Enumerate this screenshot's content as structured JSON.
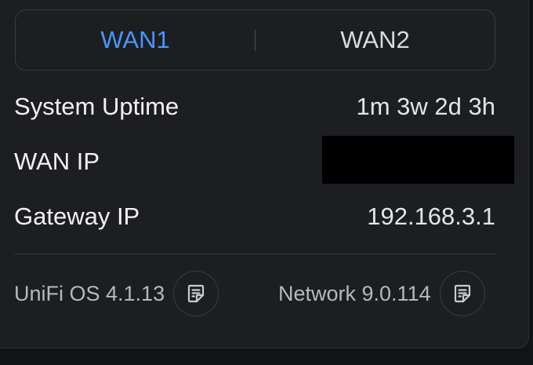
{
  "tabs": [
    {
      "label": "WAN1",
      "active": true
    },
    {
      "label": "WAN2",
      "active": false
    }
  ],
  "stats": {
    "uptime_label": "System Uptime",
    "uptime_value": "1m 3w 2d 3h",
    "wan_ip_label": "WAN IP",
    "gateway_label": "Gateway IP",
    "gateway_value": "192.168.3.1"
  },
  "footer": {
    "os_version": "UniFi OS 4.1.13",
    "network_version": "Network 9.0.114"
  },
  "icons": {
    "release_notes": "notes-icon"
  },
  "colors": {
    "accent": "#4797ff",
    "background": "#1d1e21"
  }
}
